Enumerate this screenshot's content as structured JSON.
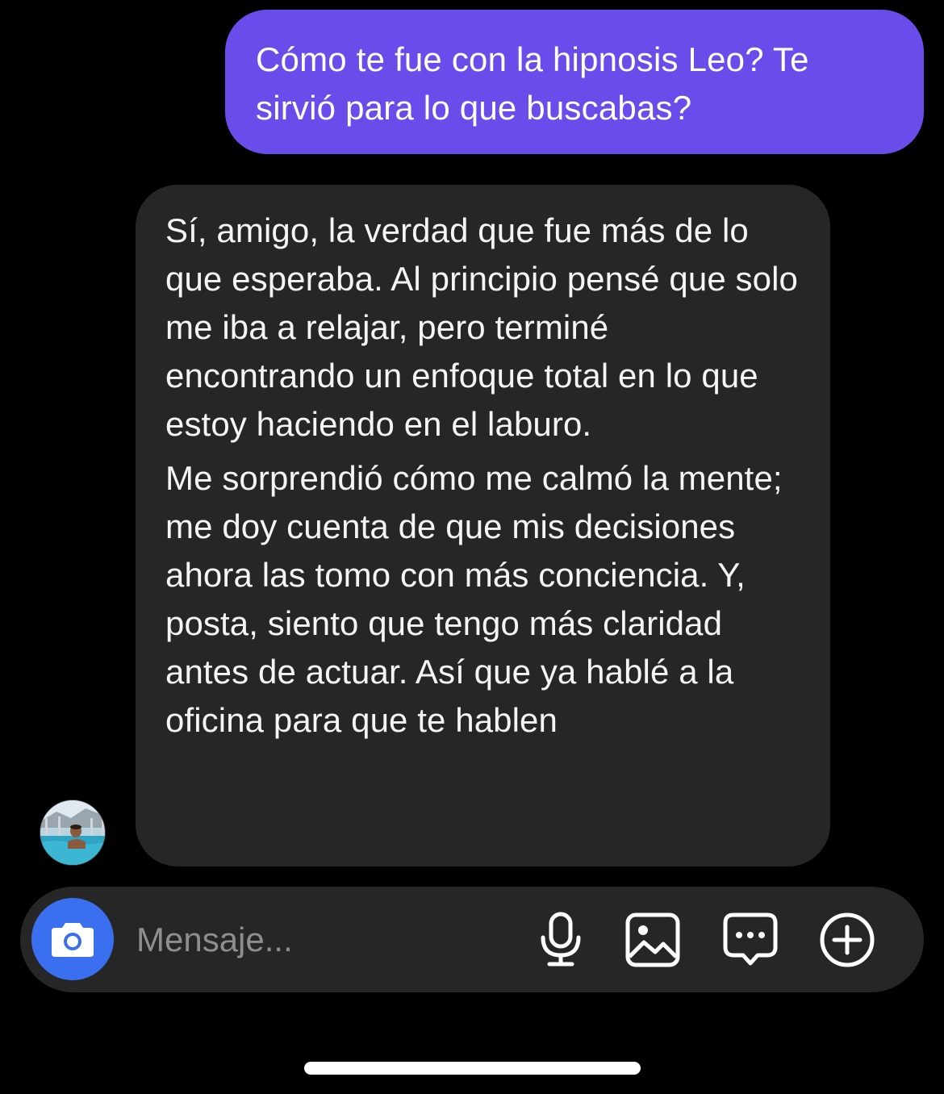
{
  "conversation": {
    "outgoing": {
      "text": "Cómo te fue con la hipnosis Leo? Te sirvió para lo que buscabas?"
    },
    "incoming": {
      "paragraph_1": "Sí, amigo, la verdad que fue más de lo que esperaba. Al principio pensé que solo me iba a relajar, pero terminé encontrando un enfoque total en lo que estoy haciendo en el laburo.",
      "paragraph_2": "Me sorprendió cómo me calmó la mente; me doy cuenta de que mis decisiones ahora las tomo con más conciencia. Y, posta, siento que tengo más claridad antes de actuar. Así que ya hablé a la oficina para que te hablen"
    },
    "sender_avatar_icon": "profile-photo"
  },
  "composer": {
    "placeholder": "Mensaje...",
    "value": "",
    "camera_icon": "camera-icon",
    "mic_icon": "microphone-icon",
    "gallery_icon": "image-icon",
    "sticker_icon": "chat-bubble-icon",
    "more_icon": "plus-circle-icon"
  },
  "colors": {
    "background": "#000000",
    "outgoing_bubble": "#6a4cea",
    "incoming_bubble": "#262626",
    "composer_bg": "#262626",
    "camera_button": "#3a6ff0",
    "placeholder_text": "#8e8e8e"
  }
}
